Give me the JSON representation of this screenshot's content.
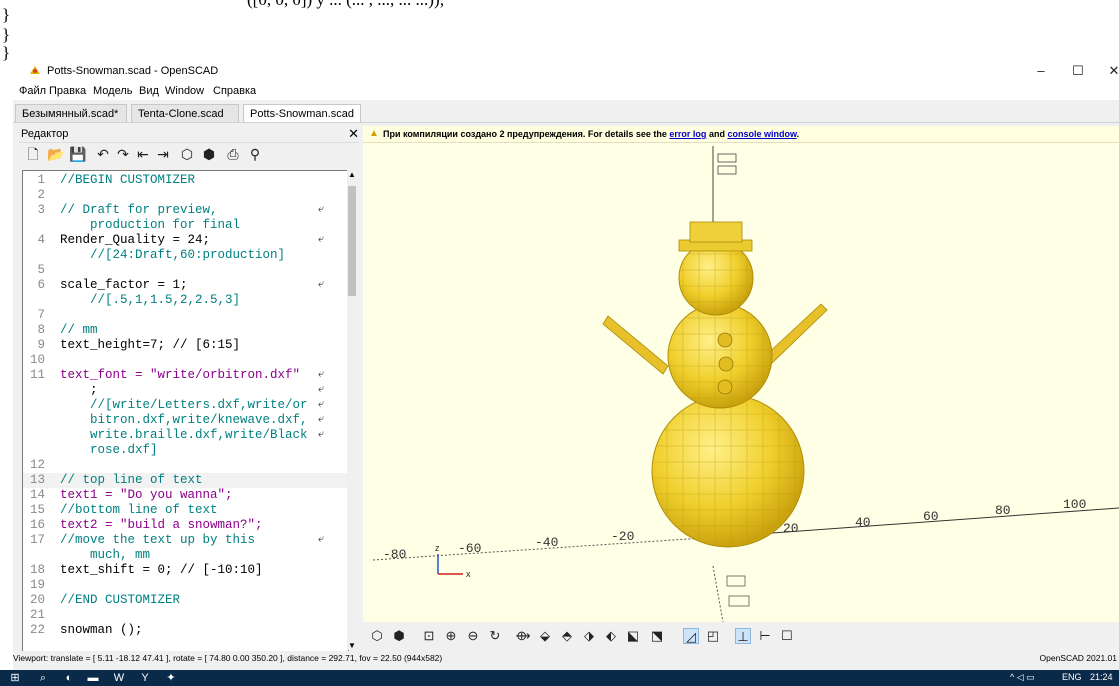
{
  "background_code": [
    "    ([0, 0, 0]) y ... (... , ..., ... ...));",
    "}",
    "}",
    "}"
  ],
  "window": {
    "title": "Potts-Snowman.scad - OpenSCAD"
  },
  "window_controls": {
    "minimize": "–",
    "maximize": "☐",
    "close": "✕"
  },
  "menu": [
    "Файл",
    "Правка",
    "Модель",
    "Вид",
    "Window",
    "Справка"
  ],
  "tabs": [
    {
      "label": "Безымянный.scad*"
    },
    {
      "label": "Tenta-Clone.scad"
    },
    {
      "label": "Potts-Snowman.scad",
      "active": true
    }
  ],
  "editor": {
    "title": "Редактор",
    "close": "✕",
    "lines": [
      {
        "n": "1",
        "text": "//BEGIN CUSTOMIZER",
        "cls": "c-com"
      },
      {
        "n": "2",
        "text": ""
      },
      {
        "n": "3",
        "text": "// Draft for preview,",
        "cls": "c-com",
        "wrap": true
      },
      {
        "n": "",
        "text": "    production for final",
        "cls": "c-com"
      },
      {
        "n": "4",
        "text": "Render_Quality = 24;",
        "cls": "c-id",
        "wrap": true
      },
      {
        "n": "",
        "text": "    //[24:Draft,60:production]",
        "cls": "c-com"
      },
      {
        "n": "5",
        "text": ""
      },
      {
        "n": "6",
        "text": "scale_factor = 1;",
        "cls": "c-id",
        "wrap": true
      },
      {
        "n": "",
        "text": "    //[.5,1,1.5,2,2.5,3]",
        "cls": "c-com"
      },
      {
        "n": "7",
        "text": ""
      },
      {
        "n": "8",
        "text": "// mm",
        "cls": "c-com"
      },
      {
        "n": "9",
        "text": "text_height=7; // [6:15]",
        "cls": "c-id"
      },
      {
        "n": "10",
        "text": ""
      },
      {
        "n": "11",
        "text": "text_font = \"write/orbitron.dxf\"",
        "cls": "c-str",
        "wrap": true
      },
      {
        "n": "",
        "text": "    ;",
        "cls": "c-id",
        "wrap": true
      },
      {
        "n": "",
        "text": "    //[write/Letters.dxf,write/or",
        "cls": "c-com",
        "wrap": true
      },
      {
        "n": "",
        "text": "    bitron.dxf,write/knewave.dxf,",
        "cls": "c-com",
        "wrap": true
      },
      {
        "n": "",
        "text": "    write.braille.dxf,write/Black",
        "cls": "c-com",
        "wrap": true
      },
      {
        "n": "",
        "text": "    rose.dxf]",
        "cls": "c-com"
      },
      {
        "n": "12",
        "text": ""
      },
      {
        "n": "13",
        "text": "// top line of text",
        "cls": "c-com",
        "highlight": true
      },
      {
        "n": "14",
        "text": "text1 = \"Do you wanna\";",
        "cls": "c-str"
      },
      {
        "n": "15",
        "text": "//bottom line of text",
        "cls": "c-com"
      },
      {
        "n": "16",
        "text": "text2 = \"build a snowman?\";",
        "cls": "c-str"
      },
      {
        "n": "17",
        "text": "//move the text up by this",
        "cls": "c-com",
        "wrap": true
      },
      {
        "n": "",
        "text": "    much, mm",
        "cls": "c-com"
      },
      {
        "n": "18",
        "text": "text_shift = 0; // [-10:10]",
        "cls": "c-id"
      },
      {
        "n": "19",
        "text": ""
      },
      {
        "n": "20",
        "text": "//END CUSTOMIZER",
        "cls": "c-com"
      },
      {
        "n": "21",
        "text": ""
      },
      {
        "n": "22",
        "text": "snowman ();",
        "cls": "c-id"
      }
    ],
    "wrap_glyph": "⤶"
  },
  "warning": {
    "prefix": "При компиляции создано 2 предупреждения. For details see the ",
    "link1": "error log",
    "mid": " and ",
    "link2": "console window",
    "suffix": "."
  },
  "axis_labels": [
    "-80",
    "-60",
    "-40",
    "-20",
    "20",
    "40",
    "60",
    "80",
    "100"
  ],
  "axis_letters": {
    "z": "z",
    "x": "x"
  },
  "status": {
    "viewport": "Viewport: translate = [ 5.11 -18.12 47.41 ], rotate = [ 74.80 0.00 350.20 ], distance = 292.71, fov = 22.50 (944x582)",
    "version": "OpenSCAD 2021.01"
  },
  "taskbar": {
    "lang": "ENG",
    "time": "21:24"
  },
  "colors": {
    "viewport_bg": "#ffffe5",
    "model": "#f2d43a",
    "accent": "#0078d7"
  }
}
